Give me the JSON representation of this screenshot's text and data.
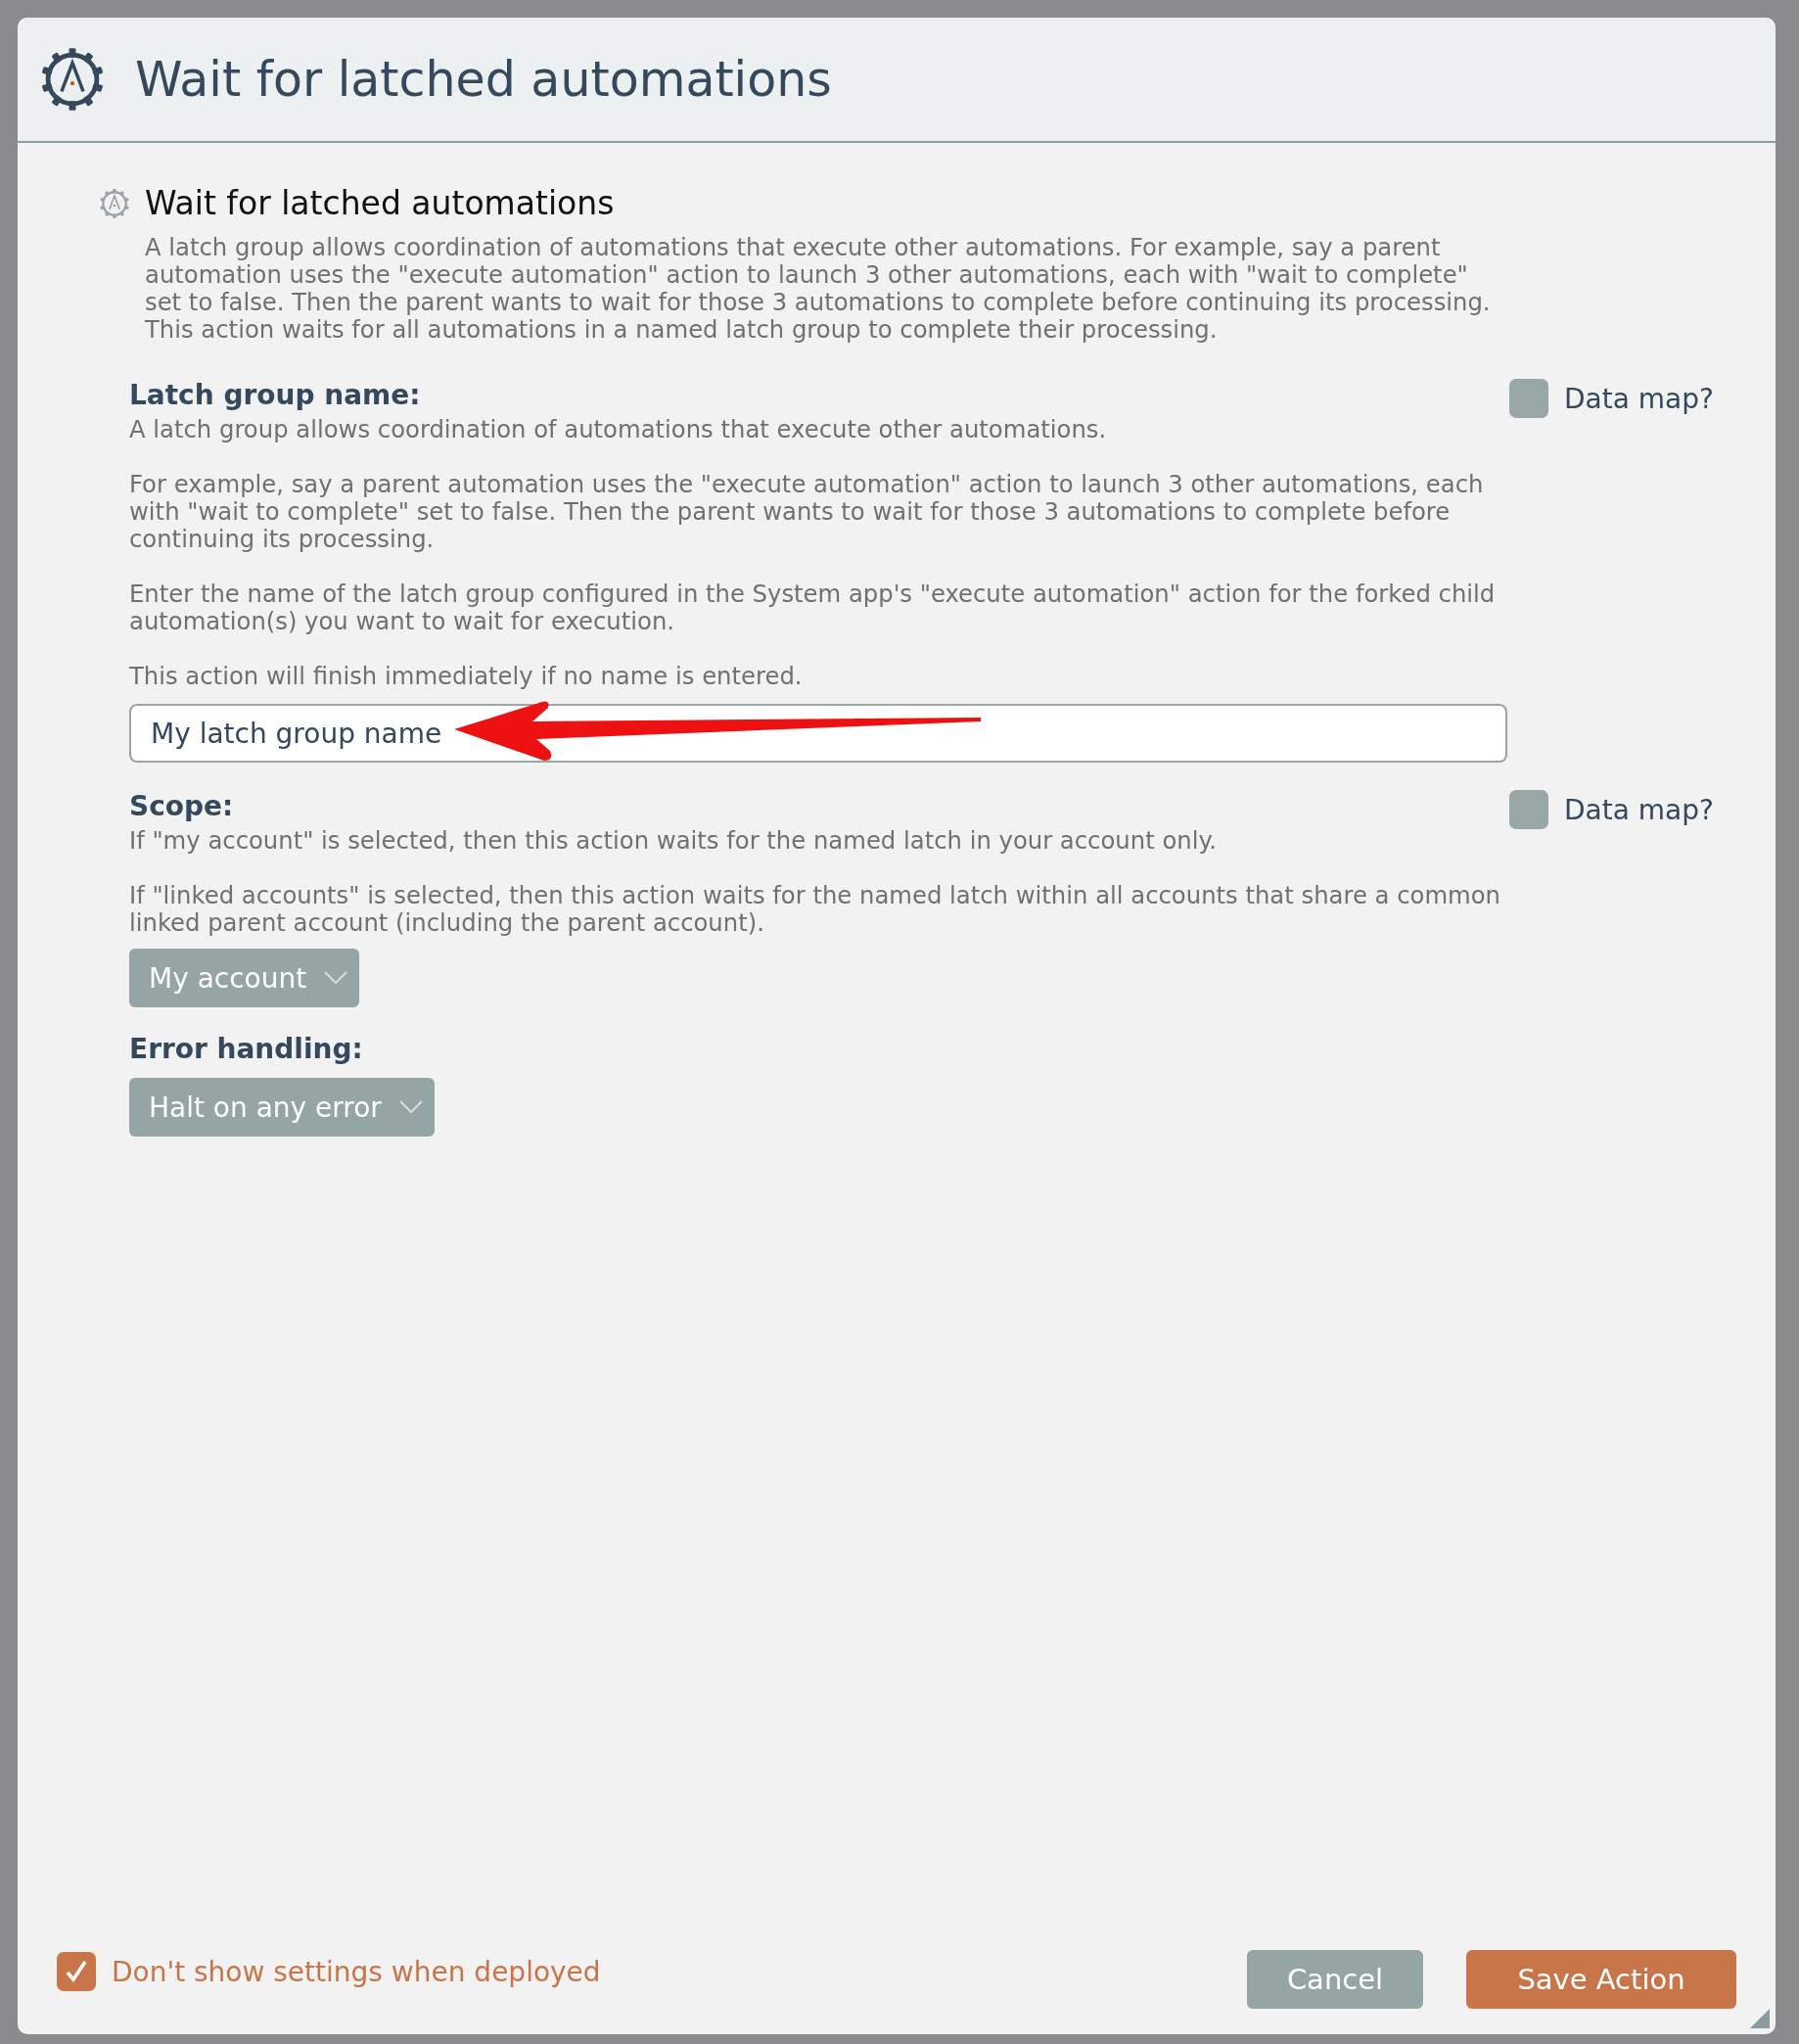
{
  "window": {
    "title": "Wait for latched automations"
  },
  "action": {
    "title": "Wait for latched automations",
    "description": "A latch group allows coordination of automations that execute other automations.  For example, say a parent automation uses the \"execute automation\" action to launch 3 other automations, each with \"wait to complete\" set to false. Then the parent wants to wait for those 3 automations to complete before continuing its processing. This action waits for all automations in a named latch group to complete their processing."
  },
  "fields": [
    {
      "label": "Latch group name:",
      "data_map": {
        "label": "Data map?",
        "checked": false
      },
      "help": [
        "A latch group allows coordination of automations that execute other automations.",
        "For example, say a parent automation uses the \"execute automation\" action to launch 3 other automations, each with \"wait to complete\" set to false. Then the parent wants to wait for those 3 automations to complete before continuing its processing.",
        "Enter the name of the latch group configured in the System app's \"execute automation\" action for the forked child automation(s) you want to wait for execution.",
        "This action will finish immediately if no name is entered."
      ],
      "control": {
        "kind": "text",
        "value": "My latch group name",
        "annotated": true
      }
    },
    {
      "label": "Scope:",
      "data_map": {
        "label": "Data map?",
        "checked": false
      },
      "help": [
        "If \"my account\" is selected, then this action waits for the named latch in your account only.",
        "If \"linked accounts\" is selected, then this action waits for the named latch within all accounts that share a common linked parent account (including the parent account)."
      ],
      "control": {
        "kind": "select",
        "value": "My account"
      }
    },
    {
      "label": "Error handling:",
      "control": {
        "kind": "select",
        "value": "Halt on any error"
      }
    }
  ],
  "footer": {
    "hide_settings": {
      "label": "Don't show settings when deployed",
      "checked": true
    },
    "buttons": [
      {
        "kind": "secondary",
        "label": "Cancel"
      },
      {
        "kind": "primary",
        "label": "Save Action"
      }
    ]
  }
}
